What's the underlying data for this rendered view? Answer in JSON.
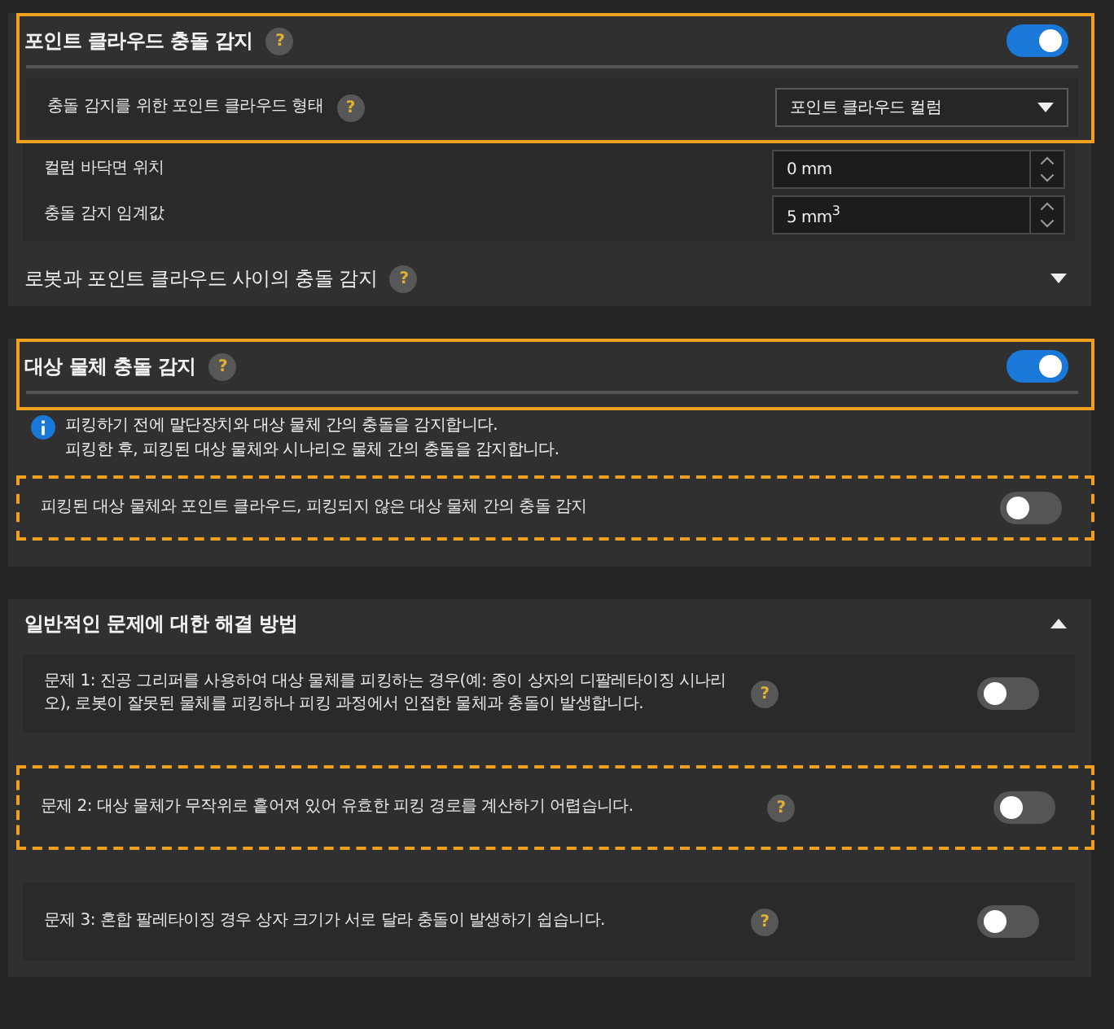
{
  "sections": [
    {
      "title": "포인트 클라우드 충돌 감지",
      "help": "?",
      "toggle": {
        "on": true
      },
      "highlighted": true,
      "rows": [
        {
          "kind": "dropdown",
          "label": "충돌 감지를 위한 포인트 클라우드 형태",
          "help": "?",
          "value": "포인트 클라우드 컬럼",
          "highlighted": true
        },
        {
          "kind": "number",
          "label": "컬럼 바닥면 위치",
          "value": "0 mm"
        },
        {
          "kind": "number",
          "label": "충돌 감지 임계값",
          "value": "5 mm$^{3}$"
        }
      ],
      "subsection": {
        "title": "로봇과 포인트 클라우드 사이의 충돌 감지",
        "help": "?",
        "expanded": false
      }
    },
    {
      "title": "대상 물체 충돌 감지",
      "help": "?",
      "toggle": {
        "on": true
      },
      "highlighted": true,
      "info": [
        "피킹하기 전에 말단장치와 대상 물체 간의 충돌을 감지합니다.",
        "피킹한 후, 피킹된 대상 물체와 시나리오 물체 간의 충돌을 감지합니다."
      ],
      "rows": [
        {
          "kind": "toggle",
          "label": "피킹된 대상 물체와 포인트 클라우드, 피킹되지 않은 대상 물체 간의 충돌 감지",
          "on": false,
          "highlighted": true
        }
      ]
    },
    {
      "title": "일반적인 문제에 대한 해결 방법",
      "expanded": true,
      "rows": [
        {
          "kind": "problem",
          "label": "문제 1: 진공 그리퍼를 사용하여 대상 물체를 피킹하는 경우(예: 종이 상자의 디팔레타이징 시나리오), 로봇이 잘못된 물체를 피킹하나 피킹 과정에서 인접한 물체과 충돌이 발생합니다.",
          "help": "?",
          "on": false
        },
        {
          "kind": "problem",
          "label": "문제 2: 대상 물체가 무작위로 흩어져 있어 유효한 피킹 경로를 계산하기 어렵습니다.",
          "help": "?",
          "on": false,
          "highlighted": true
        },
        {
          "kind": "problem",
          "label": "문제 3: 혼합 팔레타이징 경우 상자 크기가 서로 달라 충돌이 발생하기 쉽습니다.",
          "help": "?",
          "on": false
        }
      ]
    }
  ]
}
